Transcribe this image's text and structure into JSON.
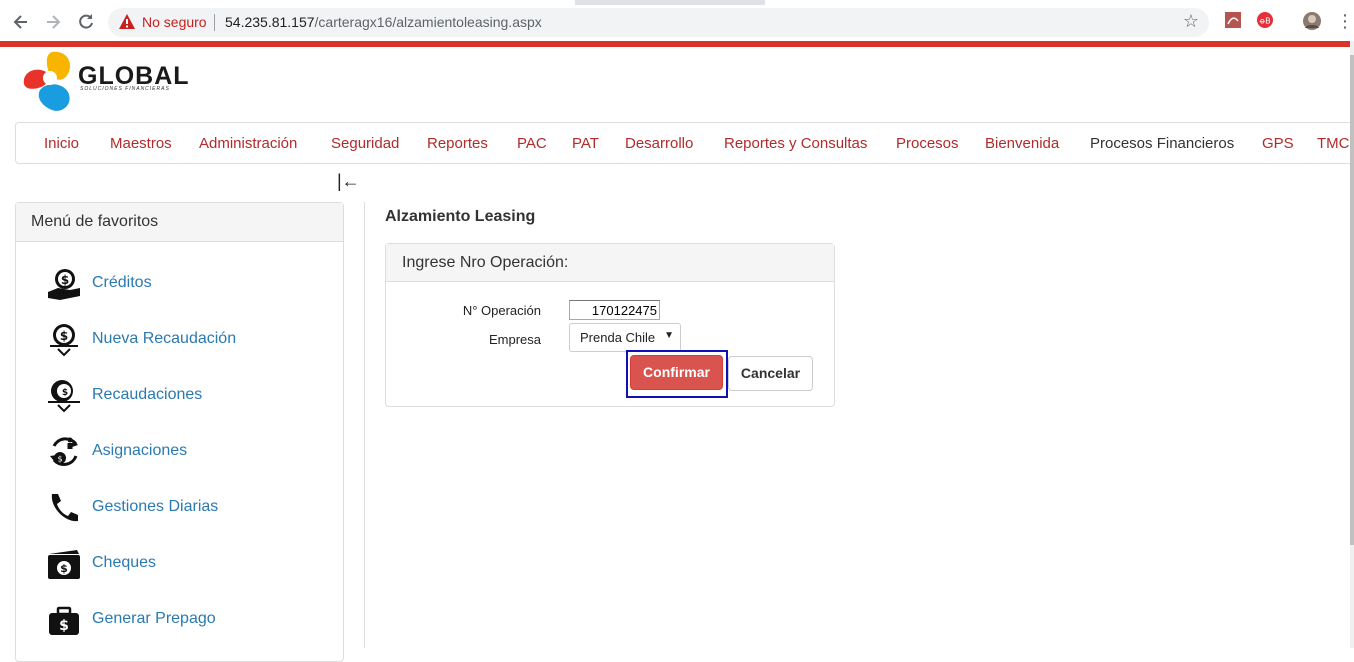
{
  "browser": {
    "security_label": "No seguro",
    "url_host": "54.235.81.157",
    "url_path": "/carteragx16/alzamientoleasing.aspx"
  },
  "brand": {
    "name": "GLOBAL",
    "tagline": "SOLUCIONES FINANCIERAS",
    "accent": "#d9332a",
    "link_color": "#2a7ab0"
  },
  "top_menu": [
    "Inicio",
    "Maestros",
    "Administración",
    "Seguridad",
    "Reportes",
    "PAC",
    "PAT",
    "Desarrollo",
    "Reportes y Consultas",
    "Procesos",
    "Bienvenida",
    "Procesos Financieros",
    "GPS",
    "TMC"
  ],
  "sidebar": {
    "title": "Menú de favoritos",
    "items": [
      {
        "label": "Créditos",
        "icon": "money-hand-icon"
      },
      {
        "label": "Nueva Recaudación",
        "icon": "money-down-icon"
      },
      {
        "label": "Recaudaciones",
        "icon": "money-list-icon"
      },
      {
        "label": "Asignaciones",
        "icon": "money-cycle-icon"
      },
      {
        "label": "Gestiones Diarias",
        "icon": "phone-icon"
      },
      {
        "label": "Cheques",
        "icon": "cheque-icon"
      },
      {
        "label": "Generar Prepago",
        "icon": "briefcase-money-icon"
      }
    ]
  },
  "main": {
    "title": "Alzamiento Leasing",
    "panel_title": "Ingrese Nro Operación:",
    "operation_label": "N° Operación",
    "operation_value": "170122475",
    "company_label": "Empresa",
    "company_value": "Prenda Chile",
    "confirm_label": "Confirmar",
    "cancel_label": "Cancelar"
  }
}
